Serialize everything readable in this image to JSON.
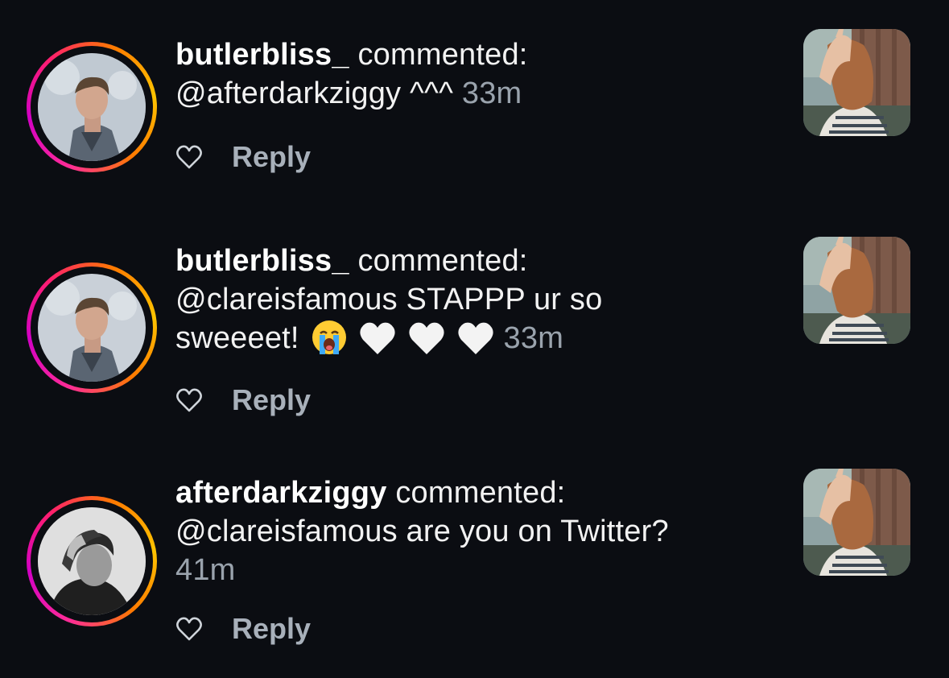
{
  "notifications": [
    {
      "username": "butlerbliss_",
      "action": "commented:",
      "text": "@afterdarkziggy ^^^",
      "time": "33m",
      "emojis": [],
      "like_icon": "heart-outline-icon",
      "reply_label": "Reply"
    },
    {
      "username": "butlerbliss_",
      "action": "commented:",
      "text": "@clareisfamous STAPPP ur so sweeeet!",
      "time": "33m",
      "emojis": [
        "loudly-crying-face",
        "white-heart",
        "white-heart",
        "white-heart"
      ],
      "like_icon": "heart-outline-icon",
      "reply_label": "Reply"
    },
    {
      "username": "afterdarkziggy",
      "action": "commented:",
      "text": "@clareisfamous are you on Twitter?",
      "time": "41m",
      "emojis": [],
      "like_icon": "heart-outline-icon",
      "reply_label": "Reply"
    }
  ],
  "colors": {
    "background": "#0b0d12",
    "text": "#f2f2f2",
    "muted": "#9aa3ad",
    "reply": "#a8b0ba",
    "ring_start": "#ff2d95",
    "ring_end": "#ffc400"
  }
}
